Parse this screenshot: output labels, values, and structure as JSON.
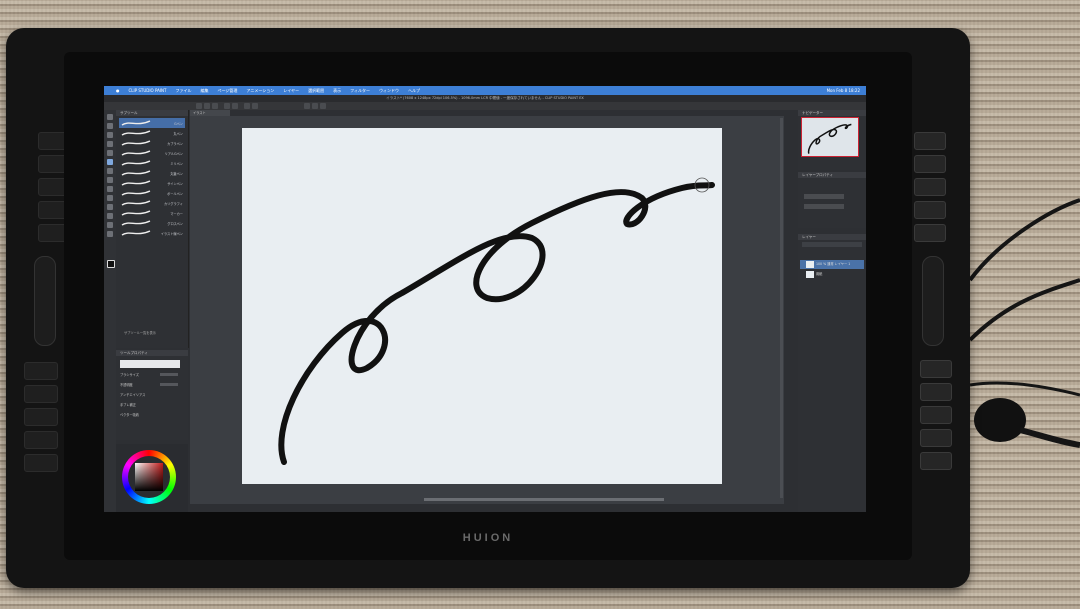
{
  "device": {
    "brand": "HUION"
  },
  "menubar": {
    "items": [
      "CLIP STUDIO PAINT",
      "ファイル",
      "編集",
      "ページ管理",
      "アニメーション",
      "レイヤー",
      "選択範囲",
      "表示",
      "フィルター",
      "ウィンドウ",
      "ヘルプ"
    ],
    "clock": "Mon Feb 8  18:22"
  },
  "titlebar": {
    "text": "イラスト* (7608 x 1248px 72dpi 106.5%) - 1096.0mm LCR 中間値 - 一度保存されていません - CLIP STUDIO PAINT EX"
  },
  "subtool": {
    "title": "サブツール",
    "brushes": [
      {
        "label": "Gペン",
        "selected": true
      },
      {
        "label": "丸ペン",
        "selected": false
      },
      {
        "label": "カブラペン",
        "selected": false
      },
      {
        "label": "リアルGペン",
        "selected": false
      },
      {
        "label": "ミリペン",
        "selected": false
      },
      {
        "label": "丸筆ペン",
        "selected": false
      },
      {
        "label": "サインペン",
        "selected": false
      },
      {
        "label": "ボールペン",
        "selected": false
      },
      {
        "label": "カリグラフィ",
        "selected": false
      },
      {
        "label": "マーカー",
        "selected": false
      },
      {
        "label": "グロスペン",
        "selected": false
      },
      {
        "label": "イラスト線ペン",
        "selected": false
      }
    ],
    "note": "サブツール一覧を表示"
  },
  "tool_property": {
    "title": "ツールプロパティ",
    "rows": [
      "ブラシサイズ",
      "不透明度",
      "アンチエイリアス",
      "手ブレ補正",
      "ベクター吸着"
    ]
  },
  "canvas": {
    "tab_label": "イラスト"
  },
  "navigator": {
    "title": "ナビゲーター"
  },
  "subpanel": {
    "title": "レイヤープロパティ"
  },
  "layers": {
    "title": "レイヤー",
    "rows": [
      {
        "name": "100 % 通常\nレイヤー 1",
        "selected": true
      },
      {
        "name": "用紙",
        "selected": false
      }
    ]
  },
  "colors": {
    "menubar": "#3d7fd6",
    "ui_bg": "#2e3034",
    "paper": "#e9eef2",
    "ink": "#111111",
    "selection": "#456ea8"
  }
}
